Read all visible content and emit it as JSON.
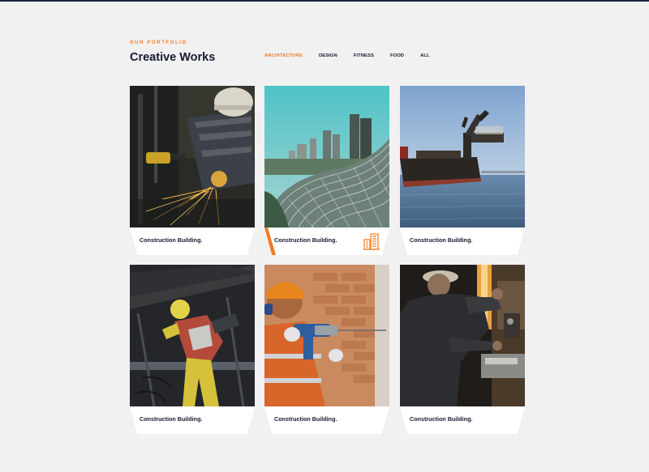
{
  "portfolio": {
    "eyebrow": "OUR PORTFOLIO",
    "title": "Creative Works"
  },
  "filters": [
    {
      "label": "ARCHITECTURE",
      "active": true
    },
    {
      "label": "DESIGN",
      "active": false
    },
    {
      "label": "FITNESS",
      "active": false
    },
    {
      "label": "FOOD",
      "active": false
    },
    {
      "label": "ALL",
      "active": false
    }
  ],
  "cards": [
    {
      "caption": "Construction Building.",
      "image": "welder-grinding-sparks",
      "highlighted": false
    },
    {
      "caption": "Construction Building.",
      "image": "curved-glass-architecture-skyline",
      "highlighted": true,
      "icon": "building-icon"
    },
    {
      "caption": "Construction Building.",
      "image": "ship-crane-at-sea",
      "highlighted": false
    },
    {
      "caption": "Construction Building.",
      "image": "worker-in-yellow-overalls",
      "highlighted": false
    },
    {
      "caption": "Construction Building.",
      "image": "worker-drilling-brick-wall",
      "highlighted": false
    },
    {
      "caption": "Construction Building.",
      "image": "worker-at-machine",
      "highlighted": false
    }
  ],
  "colors": {
    "accent": "#f47a20",
    "heading": "#141a30",
    "background": "#f1f1f1"
  }
}
